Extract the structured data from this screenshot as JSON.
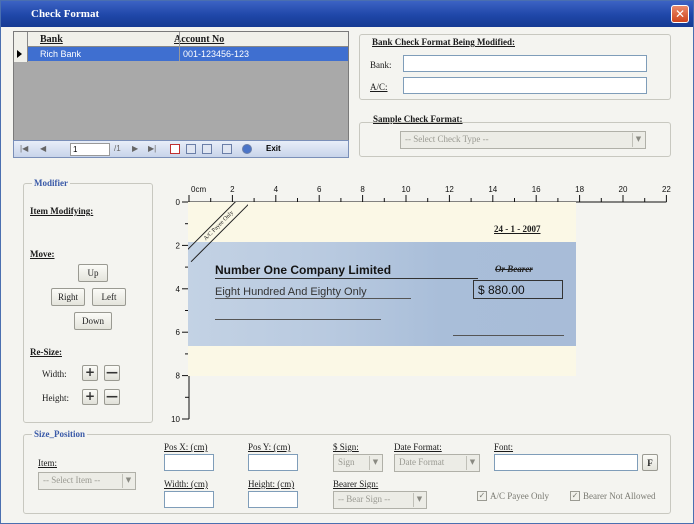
{
  "window": {
    "title": "Check Format",
    "close_glyph": "✕"
  },
  "grid": {
    "columns": [
      "Bank",
      "Account No"
    ],
    "rows": [
      {
        "bank": "Rich Bank",
        "account": "001-123456-123"
      }
    ]
  },
  "navigator": {
    "first": "|◀",
    "prev": "◀",
    "position": "1",
    "of": "/1",
    "next": "▶",
    "last": "▶|",
    "exit_label": "Exit"
  },
  "bank_format": {
    "heading": "Bank Check Format Being Modified:",
    "bank_label": "Bank:",
    "bank_value": "",
    "ac_label": "A/C:",
    "ac_value": ""
  },
  "sample_format": {
    "heading": "Sample Check Format:",
    "select_value": "-- Select Check Type --"
  },
  "modifier": {
    "legend": "Modifier",
    "item_modifying": "Item Modifying:",
    "move_label": "Move:",
    "up": "Up",
    "right": "Right",
    "left": "Left",
    "down": "Down",
    "resize_label": "Re-Size:",
    "width_label": "Width:",
    "height_label": "Height:",
    "plus": "+",
    "minus": "—"
  },
  "ruler": {
    "unit": "cm",
    "ticks": [
      "0cm",
      "2",
      "4",
      "6",
      "8",
      "10",
      "12",
      "14",
      "16",
      "18",
      "20",
      "22"
    ],
    "vticks": [
      "0",
      "2",
      "4",
      "6",
      "8",
      "10"
    ]
  },
  "check": {
    "stamp": "A/C Payee Only",
    "date": "24 - 1 - 2007",
    "payee": "Number One Company Limited",
    "bearer": "Or Bearer",
    "amount_words": "Eight Hundred And Eighty Only",
    "amount": "$ 880.00"
  },
  "size_position": {
    "legend": "Size_Position",
    "item_label": "Item:",
    "item_select": "-- Select Item --",
    "posx_label": "Pos X: (cm)",
    "posy_label": "Pos Y: (cm)",
    "width_label": "Width: (cm)",
    "height_label": "Height: (cm)",
    "sign_label": "$ Sign:",
    "sign_select": "Sign",
    "date_format_label": "Date Format:",
    "date_format_select": "Date Format",
    "font_label": "Font:",
    "font_button": "F",
    "bearer_sign_label": "Bearer Sign:",
    "bearer_sign_select": "-- Bear Sign --",
    "ac_payee_only": "A/C Payee Only",
    "bearer_not_allowed": "Bearer Not Allowed"
  }
}
